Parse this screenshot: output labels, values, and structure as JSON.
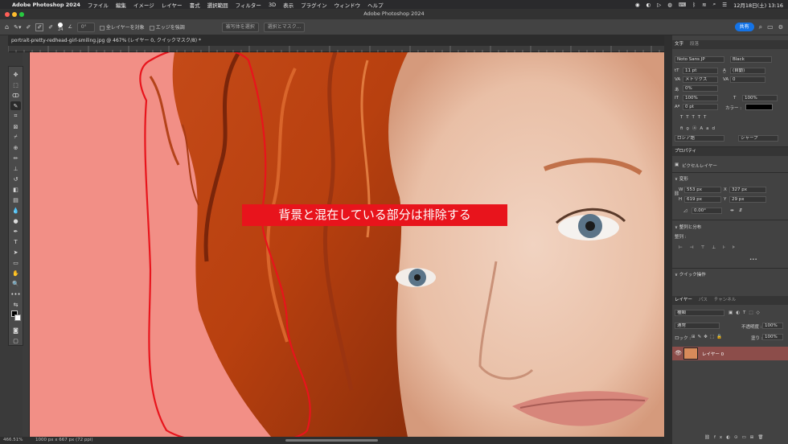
{
  "menubar": {
    "app_name": "Adobe Photoshop 2024",
    "items": [
      "ファイル",
      "編集",
      "イメージ",
      "レイヤー",
      "書式",
      "選択範囲",
      "フィルター",
      "3D",
      "表示",
      "プラグイン",
      "ウィンドウ",
      "ヘルプ"
    ],
    "clock": "12月18日(土) 13:16"
  },
  "window": {
    "title": "Adobe Photoshop 2024"
  },
  "options": {
    "size_value": "24",
    "angle_value": "0°",
    "sample_all_layers": "全レイヤーを対象",
    "enhance_edge": "エッジを強調",
    "select_subject": "被写体を選択",
    "select_mask": "選択とマスク...",
    "share": "共有"
  },
  "document": {
    "tab_title": "portrait-pretty-redhead-girl-smiling.jpg @ 467% (レイヤー 0, クイックマスク/8) *",
    "zoom": "466.51%",
    "doc_info": "1000 px x 667 px (72 ppi)"
  },
  "annotation": {
    "text": "背景と混在している部分は排除する"
  },
  "character_panel": {
    "tabs": [
      "文字",
      "段落"
    ],
    "font_family": "Noto Sans JP",
    "font_style": "Black",
    "font_size": "11 pt",
    "leading": "(自動)",
    "kerning": "メトリクス",
    "tracking": "0",
    "tsume": "0%",
    "vertical_scale": "100%",
    "horizontal_scale": "100%",
    "baseline": "0 pt",
    "color_label": "カラー :",
    "language": "ロシア語",
    "antialias": "シャープ"
  },
  "properties_panel": {
    "tab": "プロパティ",
    "layer_type": "ピクセルレイヤー",
    "transform_header": "変形",
    "w_label": "W",
    "w_value": "553 px",
    "h_label": "H",
    "h_value": "619 px",
    "x_label": "X",
    "x_value": "327 px",
    "y_label": "Y",
    "y_value": "29 px",
    "angle": "0.00°",
    "align_header": "整列と分布",
    "align_label": "整列 :",
    "quick_actions": "クイック操作"
  },
  "layers_panel": {
    "tabs": [
      "レイヤー",
      "パス",
      "チャンネル"
    ],
    "kind_label": "種類",
    "blend_mode": "通常",
    "opacity_label": "不透明度 :",
    "opacity": "100%",
    "lock_label": "ロック :",
    "fill_label": "塗り :",
    "fill": "100%",
    "layers": [
      {
        "name": "レイヤー 0"
      }
    ]
  },
  "colors": {
    "quickmask": "#f28f86",
    "annotation_bg": "#e8141c",
    "layer_selected": "#8c4d4a",
    "accent": "#1473e6"
  }
}
